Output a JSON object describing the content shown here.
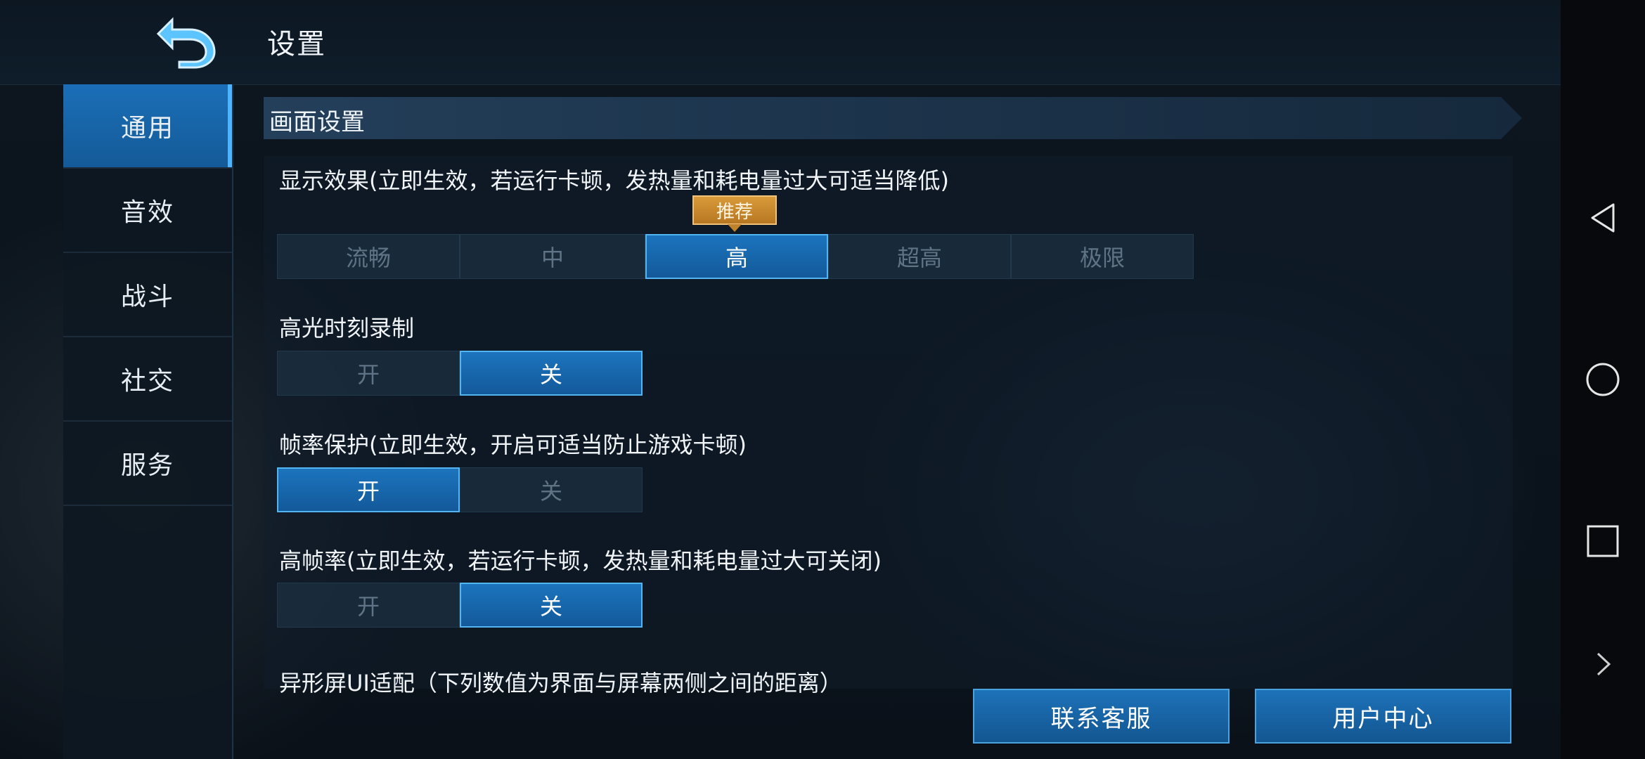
{
  "header": {
    "title": "设置"
  },
  "sidebar": {
    "items": [
      {
        "label": "通用",
        "active": true
      },
      {
        "label": "音效",
        "active": false
      },
      {
        "label": "战斗",
        "active": false
      },
      {
        "label": "社交",
        "active": false
      },
      {
        "label": "服务",
        "active": false
      }
    ]
  },
  "section": {
    "title": "画面设置"
  },
  "settings": {
    "display": {
      "label": "显示效果(立即生效，若运行卡顿，发热量和耗电量过大可适当降低)",
      "badge": "推荐",
      "options": [
        "流畅",
        "中",
        "高",
        "超高",
        "极限"
      ],
      "selected": "高"
    },
    "highlight": {
      "label": "高光时刻录制",
      "options": [
        "开",
        "关"
      ],
      "selected": "关"
    },
    "frame_protect": {
      "label": "帧率保护(立即生效，开启可适当防止游戏卡顿)",
      "options": [
        "开",
        "关"
      ],
      "selected": "开"
    },
    "high_fps": {
      "label": "高帧率(立即生效，若运行卡顿，发热量和耗电量过大可关闭)",
      "options": [
        "开",
        "关"
      ],
      "selected": "关"
    },
    "notch": {
      "label": "异形屏UI适配（下列数值为界面与屏幕两侧之间的距离）"
    }
  },
  "footer": {
    "contact_label": "联系客服",
    "user_center_label": "用户中心"
  },
  "colors": {
    "accent": "#1c74bd",
    "accent_border": "#53b4f2",
    "badge": "#d99a3a"
  },
  "icons": {
    "back": "back-arrow-icon",
    "nav_back": "triangle-back-icon",
    "nav_home": "circle-home-icon",
    "nav_recent": "square-recent-icon",
    "nav_expand": "chevron-right-icon"
  }
}
